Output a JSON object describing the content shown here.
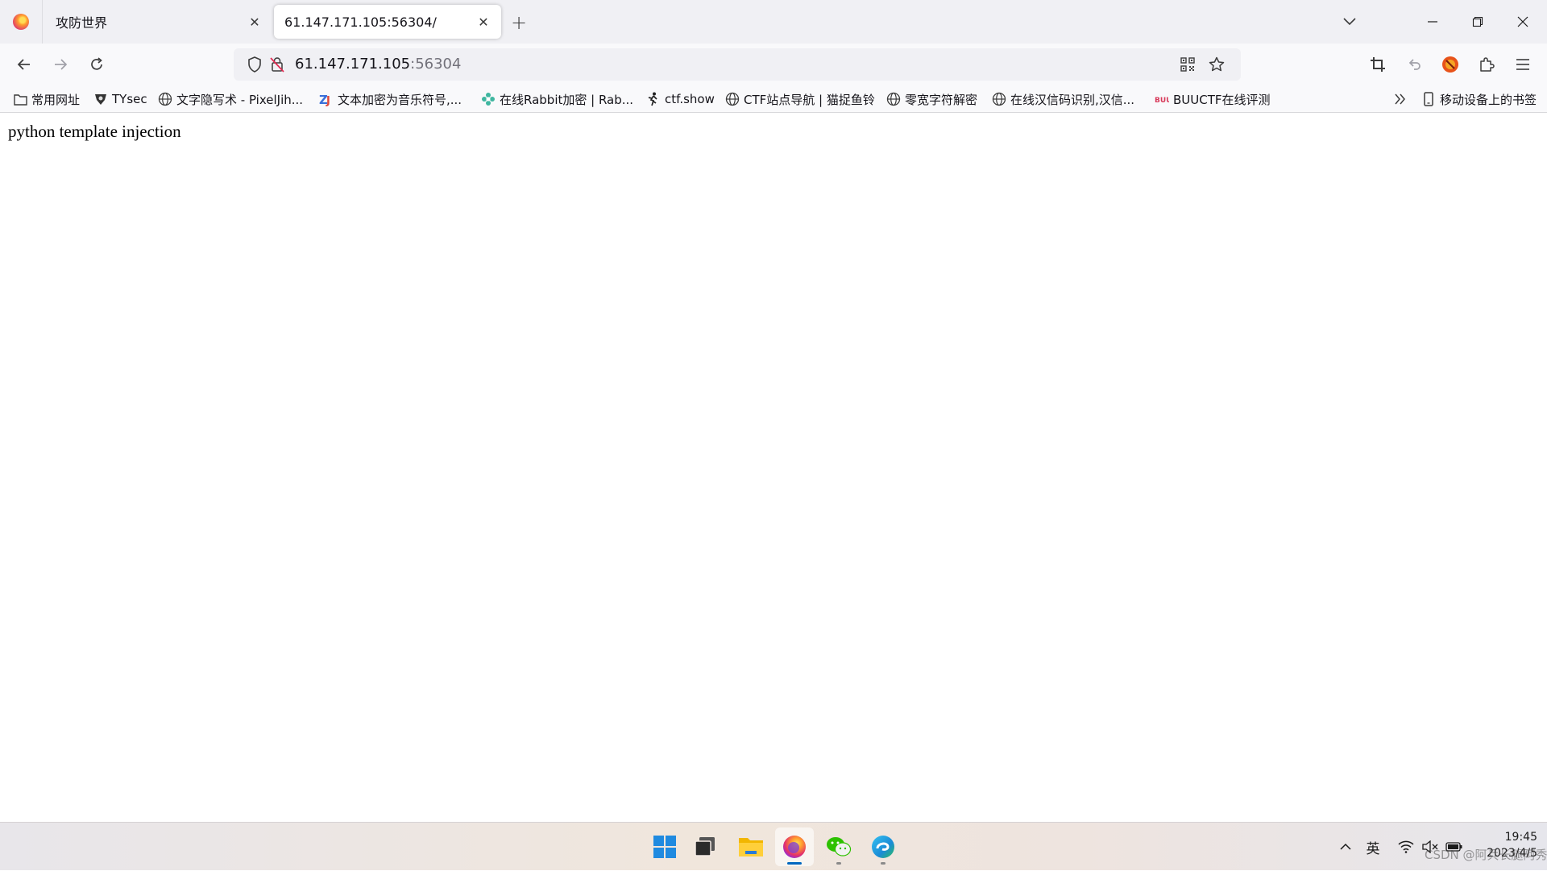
{
  "tabs": [
    {
      "title": "攻防世界",
      "active": false
    },
    {
      "title": "61.147.171.105:56304/",
      "active": true
    }
  ],
  "urlbar": {
    "host": "61.147.171.105",
    "port": ":56304"
  },
  "bookmarks": [
    {
      "label": "常用网址",
      "icon": "folder-icon"
    },
    {
      "label": "TYsec",
      "icon": "tysec-icon"
    },
    {
      "label": "文字隐写术 - PixelJih...",
      "icon": "globe-icon"
    },
    {
      "label": "文本加密为音乐符号,...",
      "icon": "zj-icon"
    },
    {
      "label": "在线Rabbit加密 | Rab...",
      "icon": "gear-flower-icon"
    },
    {
      "label": "ctf.show",
      "icon": "runner-icon"
    },
    {
      "label": "CTF站点导航 | 猫捉鱼铃",
      "icon": "globe-icon"
    },
    {
      "label": "零宽字符解密",
      "icon": "globe-icon"
    },
    {
      "label": "在线汉信码识别,汉信...",
      "icon": "globe-icon"
    },
    {
      "label": "BUUCTF在线评测",
      "icon": "buu-icon"
    }
  ],
  "mobile_bookmarks": "移动设备上的书签",
  "page": {
    "text": "python template injection"
  },
  "taskbar": {
    "tray_lang": "英",
    "time": "19:45",
    "date": "2023/4/5"
  },
  "watermark": "CSDN @阿兵长腿阿秀"
}
